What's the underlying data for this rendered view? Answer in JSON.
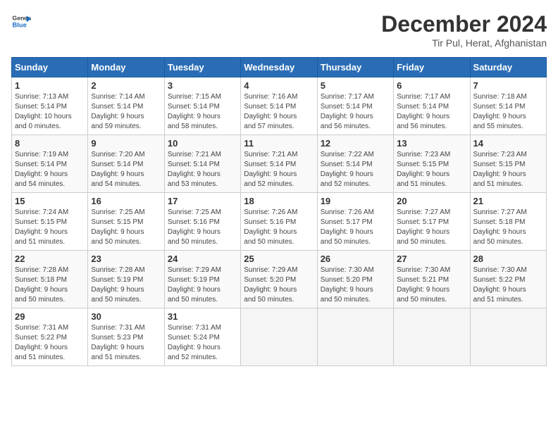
{
  "header": {
    "logo_line1": "General",
    "logo_line2": "Blue",
    "month": "December 2024",
    "location": "Tir Pul, Herat, Afghanistan"
  },
  "columns": [
    "Sunday",
    "Monday",
    "Tuesday",
    "Wednesday",
    "Thursday",
    "Friday",
    "Saturday"
  ],
  "weeks": [
    [
      {
        "day": "1",
        "lines": [
          "Sunrise: 7:13 AM",
          "Sunset: 5:14 PM",
          "Daylight: 10 hours",
          "and 0 minutes."
        ]
      },
      {
        "day": "2",
        "lines": [
          "Sunrise: 7:14 AM",
          "Sunset: 5:14 PM",
          "Daylight: 9 hours",
          "and 59 minutes."
        ]
      },
      {
        "day": "3",
        "lines": [
          "Sunrise: 7:15 AM",
          "Sunset: 5:14 PM",
          "Daylight: 9 hours",
          "and 58 minutes."
        ]
      },
      {
        "day": "4",
        "lines": [
          "Sunrise: 7:16 AM",
          "Sunset: 5:14 PM",
          "Daylight: 9 hours",
          "and 57 minutes."
        ]
      },
      {
        "day": "5",
        "lines": [
          "Sunrise: 7:17 AM",
          "Sunset: 5:14 PM",
          "Daylight: 9 hours",
          "and 56 minutes."
        ]
      },
      {
        "day": "6",
        "lines": [
          "Sunrise: 7:17 AM",
          "Sunset: 5:14 PM",
          "Daylight: 9 hours",
          "and 56 minutes."
        ]
      },
      {
        "day": "7",
        "lines": [
          "Sunrise: 7:18 AM",
          "Sunset: 5:14 PM",
          "Daylight: 9 hours",
          "and 55 minutes."
        ]
      }
    ],
    [
      {
        "day": "8",
        "lines": [
          "Sunrise: 7:19 AM",
          "Sunset: 5:14 PM",
          "Daylight: 9 hours",
          "and 54 minutes."
        ]
      },
      {
        "day": "9",
        "lines": [
          "Sunrise: 7:20 AM",
          "Sunset: 5:14 PM",
          "Daylight: 9 hours",
          "and 54 minutes."
        ]
      },
      {
        "day": "10",
        "lines": [
          "Sunrise: 7:21 AM",
          "Sunset: 5:14 PM",
          "Daylight: 9 hours",
          "and 53 minutes."
        ]
      },
      {
        "day": "11",
        "lines": [
          "Sunrise: 7:21 AM",
          "Sunset: 5:14 PM",
          "Daylight: 9 hours",
          "and 52 minutes."
        ]
      },
      {
        "day": "12",
        "lines": [
          "Sunrise: 7:22 AM",
          "Sunset: 5:14 PM",
          "Daylight: 9 hours",
          "and 52 minutes."
        ]
      },
      {
        "day": "13",
        "lines": [
          "Sunrise: 7:23 AM",
          "Sunset: 5:15 PM",
          "Daylight: 9 hours",
          "and 51 minutes."
        ]
      },
      {
        "day": "14",
        "lines": [
          "Sunrise: 7:23 AM",
          "Sunset: 5:15 PM",
          "Daylight: 9 hours",
          "and 51 minutes."
        ]
      }
    ],
    [
      {
        "day": "15",
        "lines": [
          "Sunrise: 7:24 AM",
          "Sunset: 5:15 PM",
          "Daylight: 9 hours",
          "and 51 minutes."
        ]
      },
      {
        "day": "16",
        "lines": [
          "Sunrise: 7:25 AM",
          "Sunset: 5:15 PM",
          "Daylight: 9 hours",
          "and 50 minutes."
        ]
      },
      {
        "day": "17",
        "lines": [
          "Sunrise: 7:25 AM",
          "Sunset: 5:16 PM",
          "Daylight: 9 hours",
          "and 50 minutes."
        ]
      },
      {
        "day": "18",
        "lines": [
          "Sunrise: 7:26 AM",
          "Sunset: 5:16 PM",
          "Daylight: 9 hours",
          "and 50 minutes."
        ]
      },
      {
        "day": "19",
        "lines": [
          "Sunrise: 7:26 AM",
          "Sunset: 5:17 PM",
          "Daylight: 9 hours",
          "and 50 minutes."
        ]
      },
      {
        "day": "20",
        "lines": [
          "Sunrise: 7:27 AM",
          "Sunset: 5:17 PM",
          "Daylight: 9 hours",
          "and 50 minutes."
        ]
      },
      {
        "day": "21",
        "lines": [
          "Sunrise: 7:27 AM",
          "Sunset: 5:18 PM",
          "Daylight: 9 hours",
          "and 50 minutes."
        ]
      }
    ],
    [
      {
        "day": "22",
        "lines": [
          "Sunrise: 7:28 AM",
          "Sunset: 5:18 PM",
          "Daylight: 9 hours",
          "and 50 minutes."
        ]
      },
      {
        "day": "23",
        "lines": [
          "Sunrise: 7:28 AM",
          "Sunset: 5:19 PM",
          "Daylight: 9 hours",
          "and 50 minutes."
        ]
      },
      {
        "day": "24",
        "lines": [
          "Sunrise: 7:29 AM",
          "Sunset: 5:19 PM",
          "Daylight: 9 hours",
          "and 50 minutes."
        ]
      },
      {
        "day": "25",
        "lines": [
          "Sunrise: 7:29 AM",
          "Sunset: 5:20 PM",
          "Daylight: 9 hours",
          "and 50 minutes."
        ]
      },
      {
        "day": "26",
        "lines": [
          "Sunrise: 7:30 AM",
          "Sunset: 5:20 PM",
          "Daylight: 9 hours",
          "and 50 minutes."
        ]
      },
      {
        "day": "27",
        "lines": [
          "Sunrise: 7:30 AM",
          "Sunset: 5:21 PM",
          "Daylight: 9 hours",
          "and 50 minutes."
        ]
      },
      {
        "day": "28",
        "lines": [
          "Sunrise: 7:30 AM",
          "Sunset: 5:22 PM",
          "Daylight: 9 hours",
          "and 51 minutes."
        ]
      }
    ],
    [
      {
        "day": "29",
        "lines": [
          "Sunrise: 7:31 AM",
          "Sunset: 5:22 PM",
          "Daylight: 9 hours",
          "and 51 minutes."
        ]
      },
      {
        "day": "30",
        "lines": [
          "Sunrise: 7:31 AM",
          "Sunset: 5:23 PM",
          "Daylight: 9 hours",
          "and 51 minutes."
        ]
      },
      {
        "day": "31",
        "lines": [
          "Sunrise: 7:31 AM",
          "Sunset: 5:24 PM",
          "Daylight: 9 hours",
          "and 52 minutes."
        ]
      },
      null,
      null,
      null,
      null
    ]
  ]
}
